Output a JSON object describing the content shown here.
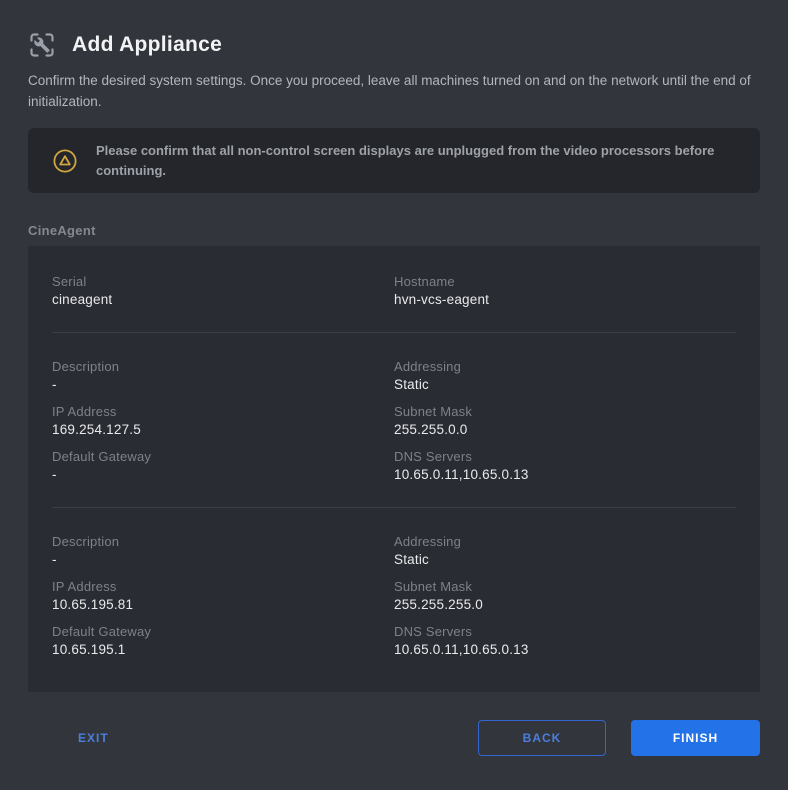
{
  "header": {
    "icon": "appliance-wrench-icon",
    "title": "Add Appliance",
    "description": "Confirm the desired system settings. Once you proceed, leave all machines turned on and on the network until the end of initialization."
  },
  "warning": {
    "icon": "warning-circle-triangle-icon",
    "text": "Please confirm that all non-control screen displays are unplugged from the video processors before continuing."
  },
  "appliance": {
    "section_label": "CineAgent",
    "identity_fields": [
      {
        "label": "Serial",
        "value": "cineagent"
      },
      {
        "label": "Hostname",
        "value": "hvn-vcs-eagent"
      }
    ],
    "network_blocks": [
      {
        "fields": [
          {
            "label": "Description",
            "value": "-"
          },
          {
            "label": "Addressing",
            "value": "Static"
          },
          {
            "label": "IP Address",
            "value": "169.254.127.5"
          },
          {
            "label": "Subnet Mask",
            "value": "255.255.0.0"
          },
          {
            "label": "Default Gateway",
            "value": "-"
          },
          {
            "label": "DNS Servers",
            "value": "10.65.0.11,10.65.0.13"
          }
        ]
      },
      {
        "fields": [
          {
            "label": "Description",
            "value": "-"
          },
          {
            "label": "Addressing",
            "value": "Static"
          },
          {
            "label": "IP Address",
            "value": "10.65.195.81"
          },
          {
            "label": "Subnet Mask",
            "value": "255.255.255.0"
          },
          {
            "label": "Default Gateway",
            "value": "10.65.195.1"
          },
          {
            "label": "DNS Servers",
            "value": "10.65.0.11,10.65.0.13"
          }
        ]
      }
    ]
  },
  "footer": {
    "exit_label": "EXIT",
    "back_label": "BACK",
    "finish_label": "FINISH"
  },
  "colors": {
    "page_background": "#33353d",
    "banner_background": "#24262b",
    "card_background": "#2a2c33",
    "accent_blue": "#2472e8",
    "link_blue": "#4a7fdd",
    "warning_gold": "#d0a63f",
    "label_gray": "#7d8188",
    "value_white": "#e9eaec"
  }
}
